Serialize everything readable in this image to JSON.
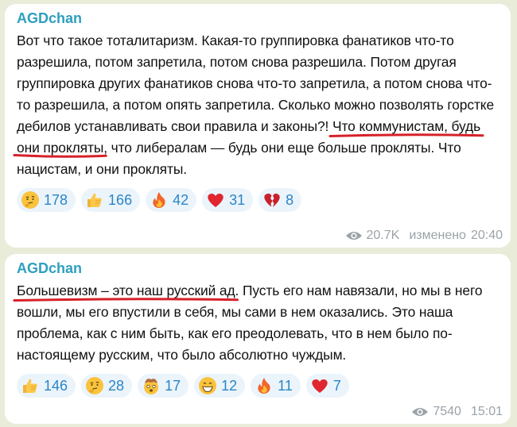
{
  "messages": [
    {
      "author": "AGDchan",
      "text_before": "Вот что такое тоталитаризм. Какая-то группировка фанатиков что-то разрешила, потом запретила, потом снова разрешила. Потом другая группировка других фанатиков снова что-то запретила, а потом снова что-то разрешила, а потом опять запретила. Сколько можно позволять горстке дебилов устанавливать свои правила и законы?! ",
      "highlight": "Что коммунистам, будь они прокляты",
      "text_after": ", что либералам — будь они еще больше прокляты. Что нацистам, и они прокляты.",
      "reactions": [
        {
          "icon": "thinking-face-emoji",
          "count": "178"
        },
        {
          "icon": "thumbs-up-emoji",
          "count": "166"
        },
        {
          "icon": "fire-emoji",
          "count": "42"
        },
        {
          "icon": "red-heart-emoji",
          "count": "31"
        },
        {
          "icon": "broken-heart-emoji",
          "count": "8"
        }
      ],
      "views": "20.7K",
      "edited_label": "изменено",
      "time": "20:40"
    },
    {
      "author": "AGDchan",
      "text_before": "",
      "highlight": "Большевизм – это наш русский ад",
      "text_after": ". Пусть его нам навязали, но мы в него вошли, мы его впустили в себя, мы сами в нем оказались. Это наша проблема, как с ним быть, как его преодолевать, что в нем было по-настоящему русским, что было абсолютно чуждым.",
      "reactions": [
        {
          "icon": "thumbs-up-emoji",
          "count": "146"
        },
        {
          "icon": "thinking-face-emoji",
          "count": "28"
        },
        {
          "icon": "exploding-head-emoji",
          "count": "17"
        },
        {
          "icon": "grinning-face-emoji",
          "count": "12"
        },
        {
          "icon": "fire-emoji",
          "count": "11"
        },
        {
          "icon": "red-heart-emoji",
          "count": "7"
        }
      ],
      "views": "7540",
      "time": "15:01"
    }
  ],
  "colors": {
    "author": "#2e9fbf",
    "underline": "#d62128",
    "reaction_bg": "#ebf4fb",
    "reaction_count": "#2b85c6",
    "meta": "#9aa3a8"
  }
}
